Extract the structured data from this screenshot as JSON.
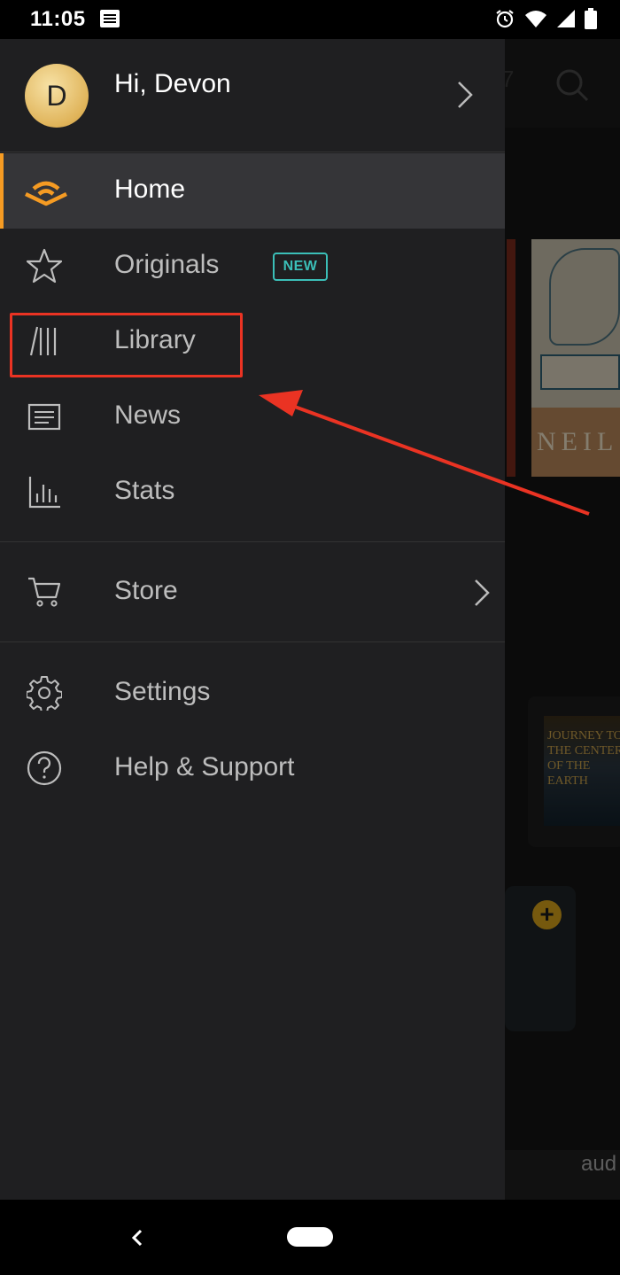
{
  "status_bar": {
    "time": "11:05",
    "icons": [
      "news-icon",
      "alarm-icon",
      "wifi-icon",
      "cell-signal-icon",
      "battery-icon"
    ]
  },
  "drawer": {
    "profile": {
      "avatar_initial": "D",
      "greeting": "Hi, Devon"
    },
    "items": [
      {
        "id": "home",
        "label": "Home",
        "icon": "audible-signal-icon",
        "active": true
      },
      {
        "id": "originals",
        "label": "Originals",
        "icon": "star-icon",
        "badge": "NEW"
      },
      {
        "id": "library",
        "label": "Library",
        "icon": "library-books-icon"
      },
      {
        "id": "news",
        "label": "News",
        "icon": "news-icon"
      },
      {
        "id": "stats",
        "label": "Stats",
        "icon": "stats-bar-icon"
      },
      {
        "id": "store",
        "label": "Store",
        "icon": "cart-icon",
        "has_chevron": true
      },
      {
        "id": "settings",
        "label": "Settings",
        "icon": "gear-icon"
      },
      {
        "id": "help",
        "label": "Help & Support",
        "icon": "help-icon"
      }
    ]
  },
  "background": {
    "book1_spine_text": "NEIL",
    "book2_cover_text": "JOURNEY TO THE CENTER OF THE EARTH",
    "partial_text": "aud"
  },
  "colors": {
    "accent": "#f59b23",
    "badge": "#3bbfb8",
    "annotation": "#ea3323",
    "drawer_bg": "#1f1f21",
    "active_bg": "#353538"
  }
}
